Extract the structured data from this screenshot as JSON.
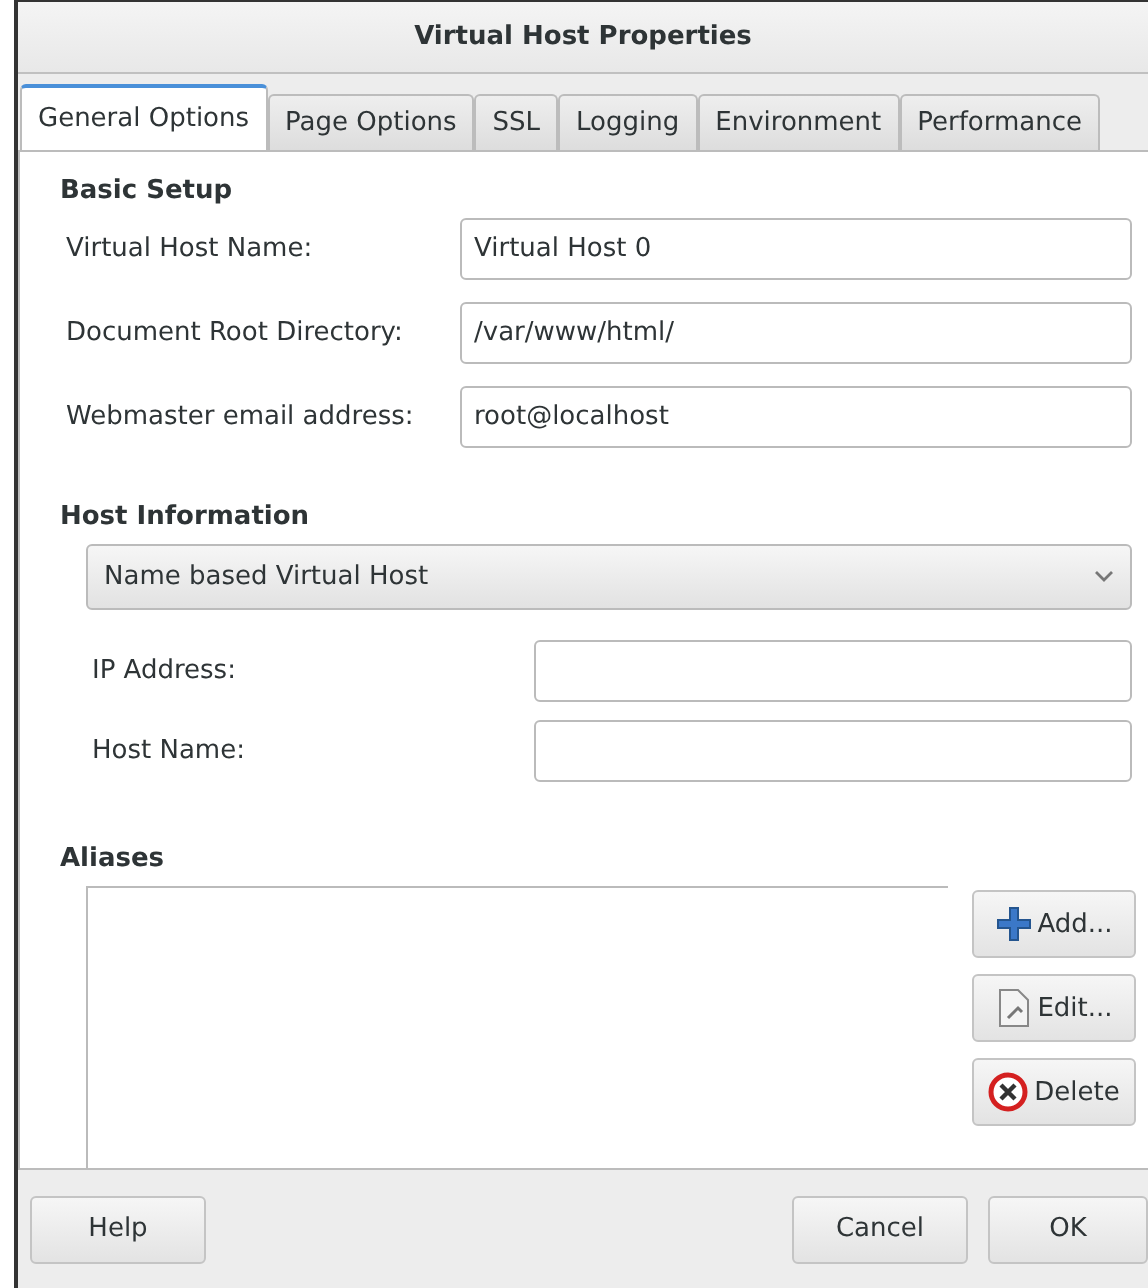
{
  "window": {
    "title": "Virtual Host Properties"
  },
  "tabs": [
    {
      "label": "General Options",
      "selected": true
    },
    {
      "label": "Page Options",
      "selected": false
    },
    {
      "label": "SSL",
      "selected": false
    },
    {
      "label": "Logging",
      "selected": false
    },
    {
      "label": "Environment",
      "selected": false
    },
    {
      "label": "Performance",
      "selected": false
    }
  ],
  "basic_setup": {
    "heading": "Basic Setup",
    "fields": [
      {
        "label": "Virtual Host Name:",
        "value": "Virtual Host 0"
      },
      {
        "label": "Document Root Directory:",
        "value": "/var/www/html/"
      },
      {
        "label": "Webmaster email address:",
        "value": "root@localhost"
      }
    ]
  },
  "host_information": {
    "heading": "Host Information",
    "host_type": "Name based Virtual Host",
    "fields": [
      {
        "label": "IP Address:"
      },
      {
        "label": "Host Name:"
      }
    ]
  },
  "aliases": {
    "heading": "Aliases",
    "buttons": [
      {
        "label": "Add...",
        "kind": "add"
      },
      {
        "label": "Edit...",
        "kind": "edit"
      },
      {
        "label": "Delete",
        "kind": "delete"
      }
    ]
  },
  "footer_buttons": [
    {
      "label": "Help",
      "kind": "help"
    },
    {
      "label": "Cancel",
      "kind": "cancel"
    },
    {
      "label": "OK",
      "kind": "ok"
    }
  ]
}
